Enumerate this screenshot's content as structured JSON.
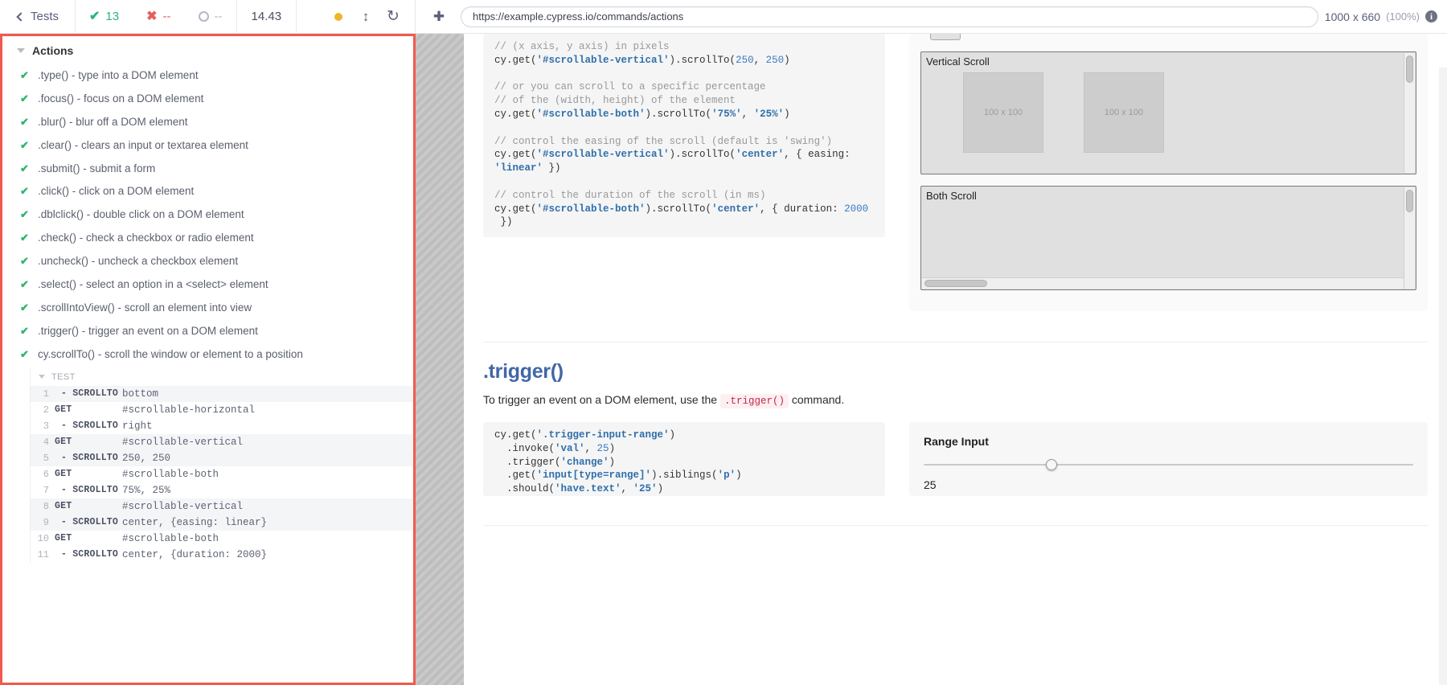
{
  "topbar": {
    "back_label": "Tests",
    "stats": {
      "passed": "13",
      "failed": "--",
      "pending": "--",
      "duration": "14.43"
    },
    "icons": {
      "back": "chevron-left-icon",
      "pass": "check-icon",
      "fail": "x-icon",
      "pending": "circle-icon",
      "record": "dot-icon",
      "resize": "updown-arrow-icon",
      "reload": "reload-icon",
      "selector_playground": "crosshair-icon",
      "info": "info-icon"
    },
    "url": "https://example.cypress.io/commands/actions",
    "url_placeholder": "https://",
    "viewport": "1000 x 660",
    "viewport_scale": "(100%)"
  },
  "reporter": {
    "suite_title": "Actions",
    "tests": [
      {
        "label": ".type() - type into a DOM element",
        "state": "passed"
      },
      {
        "label": ".focus() - focus on a DOM element",
        "state": "passed"
      },
      {
        "label": ".blur() - blur off a DOM element",
        "state": "passed"
      },
      {
        "label": ".clear() - clears an input or textarea element",
        "state": "passed"
      },
      {
        "label": ".submit() - submit a form",
        "state": "passed"
      },
      {
        "label": ".click() - click on a DOM element",
        "state": "passed"
      },
      {
        "label": ".dblclick() - double click on a DOM element",
        "state": "passed"
      },
      {
        "label": ".check() - check a checkbox or radio element",
        "state": "passed"
      },
      {
        "label": ".uncheck() - uncheck a checkbox element",
        "state": "passed"
      },
      {
        "label": ".select() - select an option in a <select> element",
        "state": "passed"
      },
      {
        "label": ".scrollIntoView() - scroll an element into view",
        "state": "passed"
      },
      {
        "label": ".trigger() - trigger an event on a DOM element",
        "state": "passed"
      },
      {
        "label": "cy.scrollTo() - scroll the window or element to a position",
        "state": "passed"
      }
    ],
    "command_log": {
      "section_label": "TEST",
      "commands": [
        {
          "num": "1",
          "name": "- SCROLLTO",
          "message": "bottom",
          "child": true
        },
        {
          "num": "2",
          "name": "GET",
          "message": "#scrollable-horizontal",
          "child": false
        },
        {
          "num": "3",
          "name": "- SCROLLTO",
          "message": "right",
          "child": true
        },
        {
          "num": "4",
          "name": "GET",
          "message": "#scrollable-vertical",
          "child": false
        },
        {
          "num": "5",
          "name": "- SCROLLTO",
          "message": "250, 250",
          "child": true
        },
        {
          "num": "6",
          "name": "GET",
          "message": "#scrollable-both",
          "child": false
        },
        {
          "num": "7",
          "name": "- SCROLLTO",
          "message": "75%, 25%",
          "child": true
        },
        {
          "num": "8",
          "name": "GET",
          "message": "#scrollable-vertical",
          "child": false
        },
        {
          "num": "9",
          "name": "- SCROLLTO",
          "message": "center, {easing: linear}",
          "child": true
        },
        {
          "num": "10",
          "name": "GET",
          "message": "#scrollable-both",
          "child": false
        },
        {
          "num": "11",
          "name": "- SCROLLTO",
          "message": "center, {duration: 2000}",
          "child": true
        }
      ]
    }
  },
  "aut": {
    "scrollto_code": {
      "l1": "// (x axis, y axis) in pixels",
      "l2a": "cy.get(",
      "l2b": "'#scrollable-vertical'",
      "l2c": ").scrollTo(",
      "l2d": "250",
      "l2e": ", ",
      "l2f": "250",
      "l2g": ")",
      "l3": "// or you can scroll to a specific percentage",
      "l4": "// of the (width, height) of the element",
      "l5a": "cy.get(",
      "l5b": "'#scrollable-both'",
      "l5c": ").scrollTo(",
      "l5d": "'75%'",
      "l5e": ", ",
      "l5f": "'25%'",
      "l5g": ")",
      "l6": "// control the easing of the scroll (default is 'swing')",
      "l7a": "cy.get(",
      "l7b": "'#scrollable-vertical'",
      "l7c": ").scrollTo(",
      "l7d": "'center'",
      "l7e": ", { easing: ",
      "l7f": "'linear'",
      "l7g": " })",
      "l8": "// control the duration of the scroll (in ms)",
      "l9a": "cy.get(",
      "l9b": "'#scrollable-both'",
      "l9c": ").scrollTo(",
      "l9d": "'center'",
      "l9e": ", { duration: ",
      "l9f": "2000",
      "l9g": " })"
    },
    "demos": {
      "vertical_title": "Vertical Scroll",
      "both_title": "Both Scroll",
      "inner_label": "100 x 100"
    },
    "trigger": {
      "heading": ".trigger()",
      "desc_before": "To trigger an event on a DOM element, use the",
      "desc_code": ".trigger()",
      "desc_after": "command.",
      "code": {
        "l1a": "cy.get(",
        "l1b": "'.trigger-input-range'",
        "l1c": ")",
        "l2a": "  .invoke(",
        "l2b": "'val'",
        "l2c": ", ",
        "l2d": "25",
        "l2e": ")",
        "l3a": "  .trigger(",
        "l3b": "'change'",
        "l3c": ")",
        "l4a": "  .get(",
        "l4b": "'input[type=range]'",
        "l4c": ").siblings(",
        "l4d": "'p'",
        "l4e": ")",
        "l5a": "  .should(",
        "l5b": "'have.text'",
        "l5c": ", ",
        "l5d": "'25'",
        "l5e": ")"
      },
      "range_panel_title": "Range Input",
      "range_value": "25",
      "range_min": "0",
      "range_max": "100"
    }
  }
}
